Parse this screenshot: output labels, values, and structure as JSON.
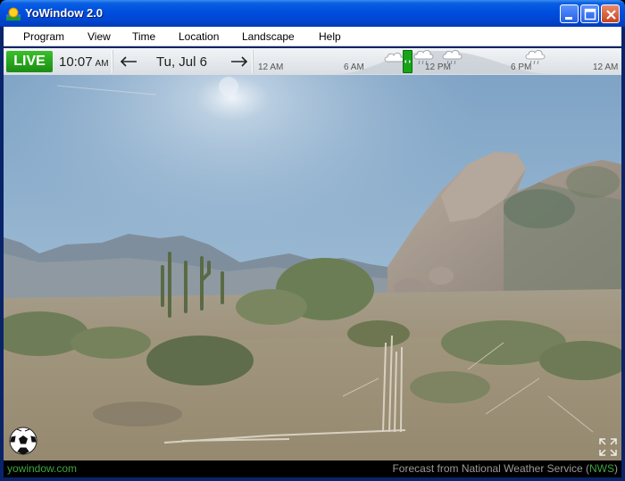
{
  "window": {
    "title": "YoWindow 2.0"
  },
  "menu": {
    "items": [
      "Program",
      "View",
      "Time",
      "Location",
      "Landscape",
      "Help"
    ]
  },
  "timebar": {
    "live_label": "LIVE",
    "time": "10:07",
    "ampm": "AM",
    "date": "Tu, Jul 6",
    "ticks": [
      "12 AM",
      "6 AM",
      "12 PM",
      "6 PM",
      "12 AM"
    ]
  },
  "footer": {
    "site": "yowindow.com",
    "credit_prefix": "Forecast from National Weather Service (",
    "credit_link": "NWS",
    "credit_suffix": ")"
  },
  "colors": {
    "live_green": "#1a8d12",
    "titlebar_blue": "#0050e0",
    "footer_green": "#3ea63e"
  }
}
